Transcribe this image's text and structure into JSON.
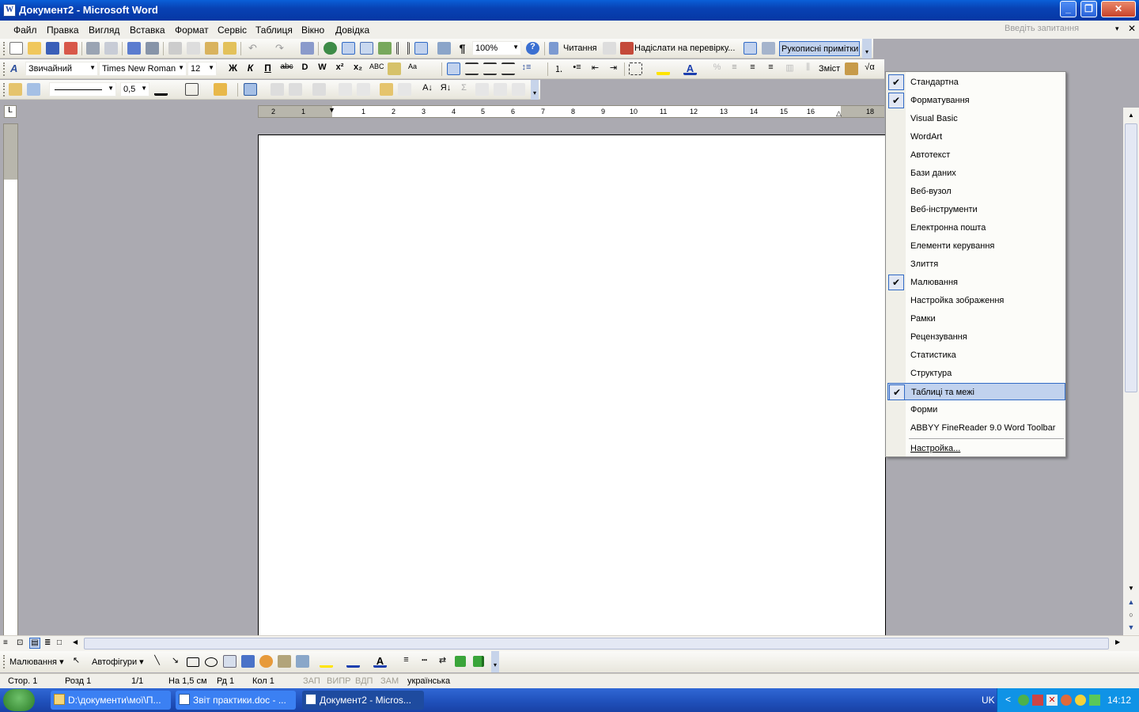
{
  "window": {
    "title": "Документ2 - Microsoft Word",
    "app_icon": "word-doc-icon",
    "minimize": "_",
    "restore": "❐",
    "close": "✕"
  },
  "menubar": {
    "items": [
      "Файл",
      "Правка",
      "Вигляд",
      "Вставка",
      "Формат",
      "Сервіс",
      "Таблиця",
      "Вікно",
      "Довідка"
    ],
    "ask_placeholder": "Введіть запитання"
  },
  "standard_toolbar": {
    "zoom": "100%",
    "reading_label": "Читання",
    "send_review_label": "Надіслати на перевірку...",
    "ink_comments_label": "Рукописні примітки"
  },
  "formatting_toolbar": {
    "style": "Звичайний",
    "font": "Times New Roman",
    "size": "12",
    "bold": "Ж",
    "italic": "К",
    "underline": "П",
    "contents_label": "Зміст"
  },
  "tables_toolbar": {
    "line_weight": "0,5"
  },
  "ruler": {
    "numbers": [
      "2",
      "1",
      "1",
      "2",
      "3",
      "4",
      "5",
      "6",
      "7",
      "8",
      "9",
      "10",
      "11",
      "12",
      "13",
      "14",
      "15",
      "16",
      "18"
    ]
  },
  "context_menu": {
    "items": [
      {
        "label": "Стандартна",
        "checked": true
      },
      {
        "label": "Форматування",
        "checked": true
      },
      {
        "label": "Visual Basic",
        "checked": false
      },
      {
        "label": "WordArt",
        "checked": false
      },
      {
        "label": "Автотекст",
        "checked": false
      },
      {
        "label": "Бази даних",
        "checked": false
      },
      {
        "label": "Веб-вузол",
        "checked": false
      },
      {
        "label": "Веб-інструменти",
        "checked": false
      },
      {
        "label": "Електронна пошта",
        "checked": false
      },
      {
        "label": "Елементи керування",
        "checked": false
      },
      {
        "label": "Злиття",
        "checked": false
      },
      {
        "label": "Малювання",
        "checked": true
      },
      {
        "label": "Настройка зображення",
        "checked": false
      },
      {
        "label": "Рамки",
        "checked": false
      },
      {
        "label": "Рецензування",
        "checked": false
      },
      {
        "label": "Статистика",
        "checked": false
      },
      {
        "label": "Структура",
        "checked": false
      },
      {
        "label": "Таблиці та межі",
        "checked": true,
        "highlighted": true
      },
      {
        "label": "Форми",
        "checked": false
      },
      {
        "label": "ABBYY FineReader 9.0 Word Toolbar",
        "checked": false
      }
    ],
    "customize_label": "Настройка..."
  },
  "drawing_toolbar": {
    "draw_label": "Малювання ▾",
    "autoshapes_label": "Автофігури ▾"
  },
  "statusbar": {
    "page": "Стор. 1",
    "section": "Розд 1",
    "pages": "1/1",
    "at": "На 1,5 см",
    "line": "Рд 1",
    "col": "Кол 1",
    "rec": "ЗАП",
    "trk": "ВИПР",
    "ext": "ВДП",
    "ovr": "ЗАМ",
    "lang": "українська"
  },
  "taskbar": {
    "tasks": [
      {
        "label": "D:\\документи\\мої\\П...",
        "active": false
      },
      {
        "label": "Звіт практики.doc - ...",
        "active": false
      },
      {
        "label": "Документ2 - Micros...",
        "active": true
      }
    ],
    "lang": "UK",
    "clock": "14:12"
  },
  "colors": {
    "title_bar": "#0a5fd8",
    "menu_highlight": "#c1d2ee",
    "menu_border": "#316ac5",
    "workspace": "#abaab1",
    "taskbar": "#245edb"
  }
}
